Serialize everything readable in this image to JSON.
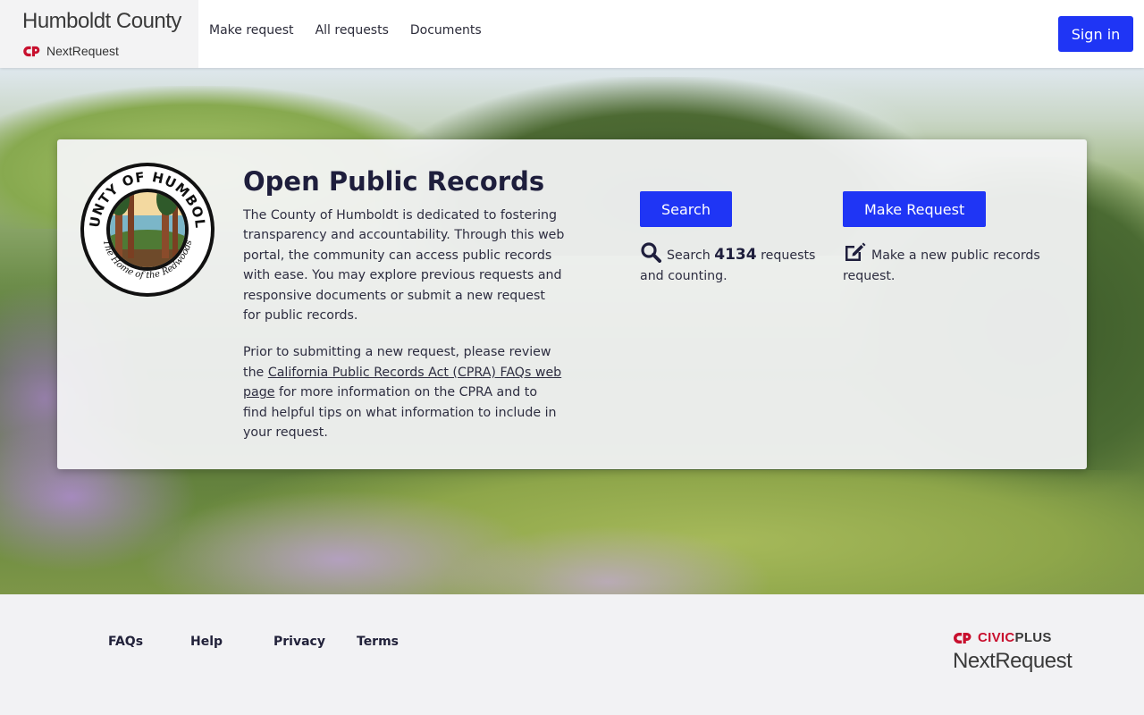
{
  "header": {
    "brand_title": "Humboldt County",
    "brand_sub": "NextRequest",
    "nav": [
      {
        "label": "Make request"
      },
      {
        "label": "All requests"
      },
      {
        "label": "Documents"
      }
    ],
    "signin_label": "Sign in"
  },
  "hero": {
    "seal_top_text": "COUNTY OF HUMBOLDT",
    "seal_bottom_text": "The Home of the Redwoods",
    "title": "Open Public Records",
    "intro": "The County of Humboldt is dedicated to fostering transparency and accountability. Through this web portal, the community can access public records with ease. You may explore previous requests and responsive documents or submit a new request for public records.",
    "prior_text": "Prior to submitting a new request, please review the",
    "cpra_link": "California Public Records Act (CPRA) FAQs web page",
    "after_link": "for more information on the CPRA and to find helpful tips on what information to include in your request.",
    "search": {
      "button_label": "Search",
      "desc_prefix": "Search",
      "count": "4134",
      "desc_suffix": "requests and counting."
    },
    "make_request": {
      "button_label": "Make Request",
      "desc": "Make a new public records request."
    }
  },
  "footer": {
    "links": [
      {
        "label": "FAQs"
      },
      {
        "label": "Help"
      },
      {
        "label": "Privacy"
      },
      {
        "label": "Terms"
      }
    ],
    "civic_brand": "CIVIC",
    "civic_brand_plus": "PLUS",
    "civic_product": "NextRequest"
  },
  "colors": {
    "accent": "#1f35f5",
    "civic_red": "#c8102e",
    "title_text": "#1e1e3c"
  },
  "icons": {
    "brand_logo": "nextrequest-logo-icon",
    "search": "search-icon",
    "make_request": "edit-icon",
    "civic_logo": "civicplus-logo-icon"
  }
}
